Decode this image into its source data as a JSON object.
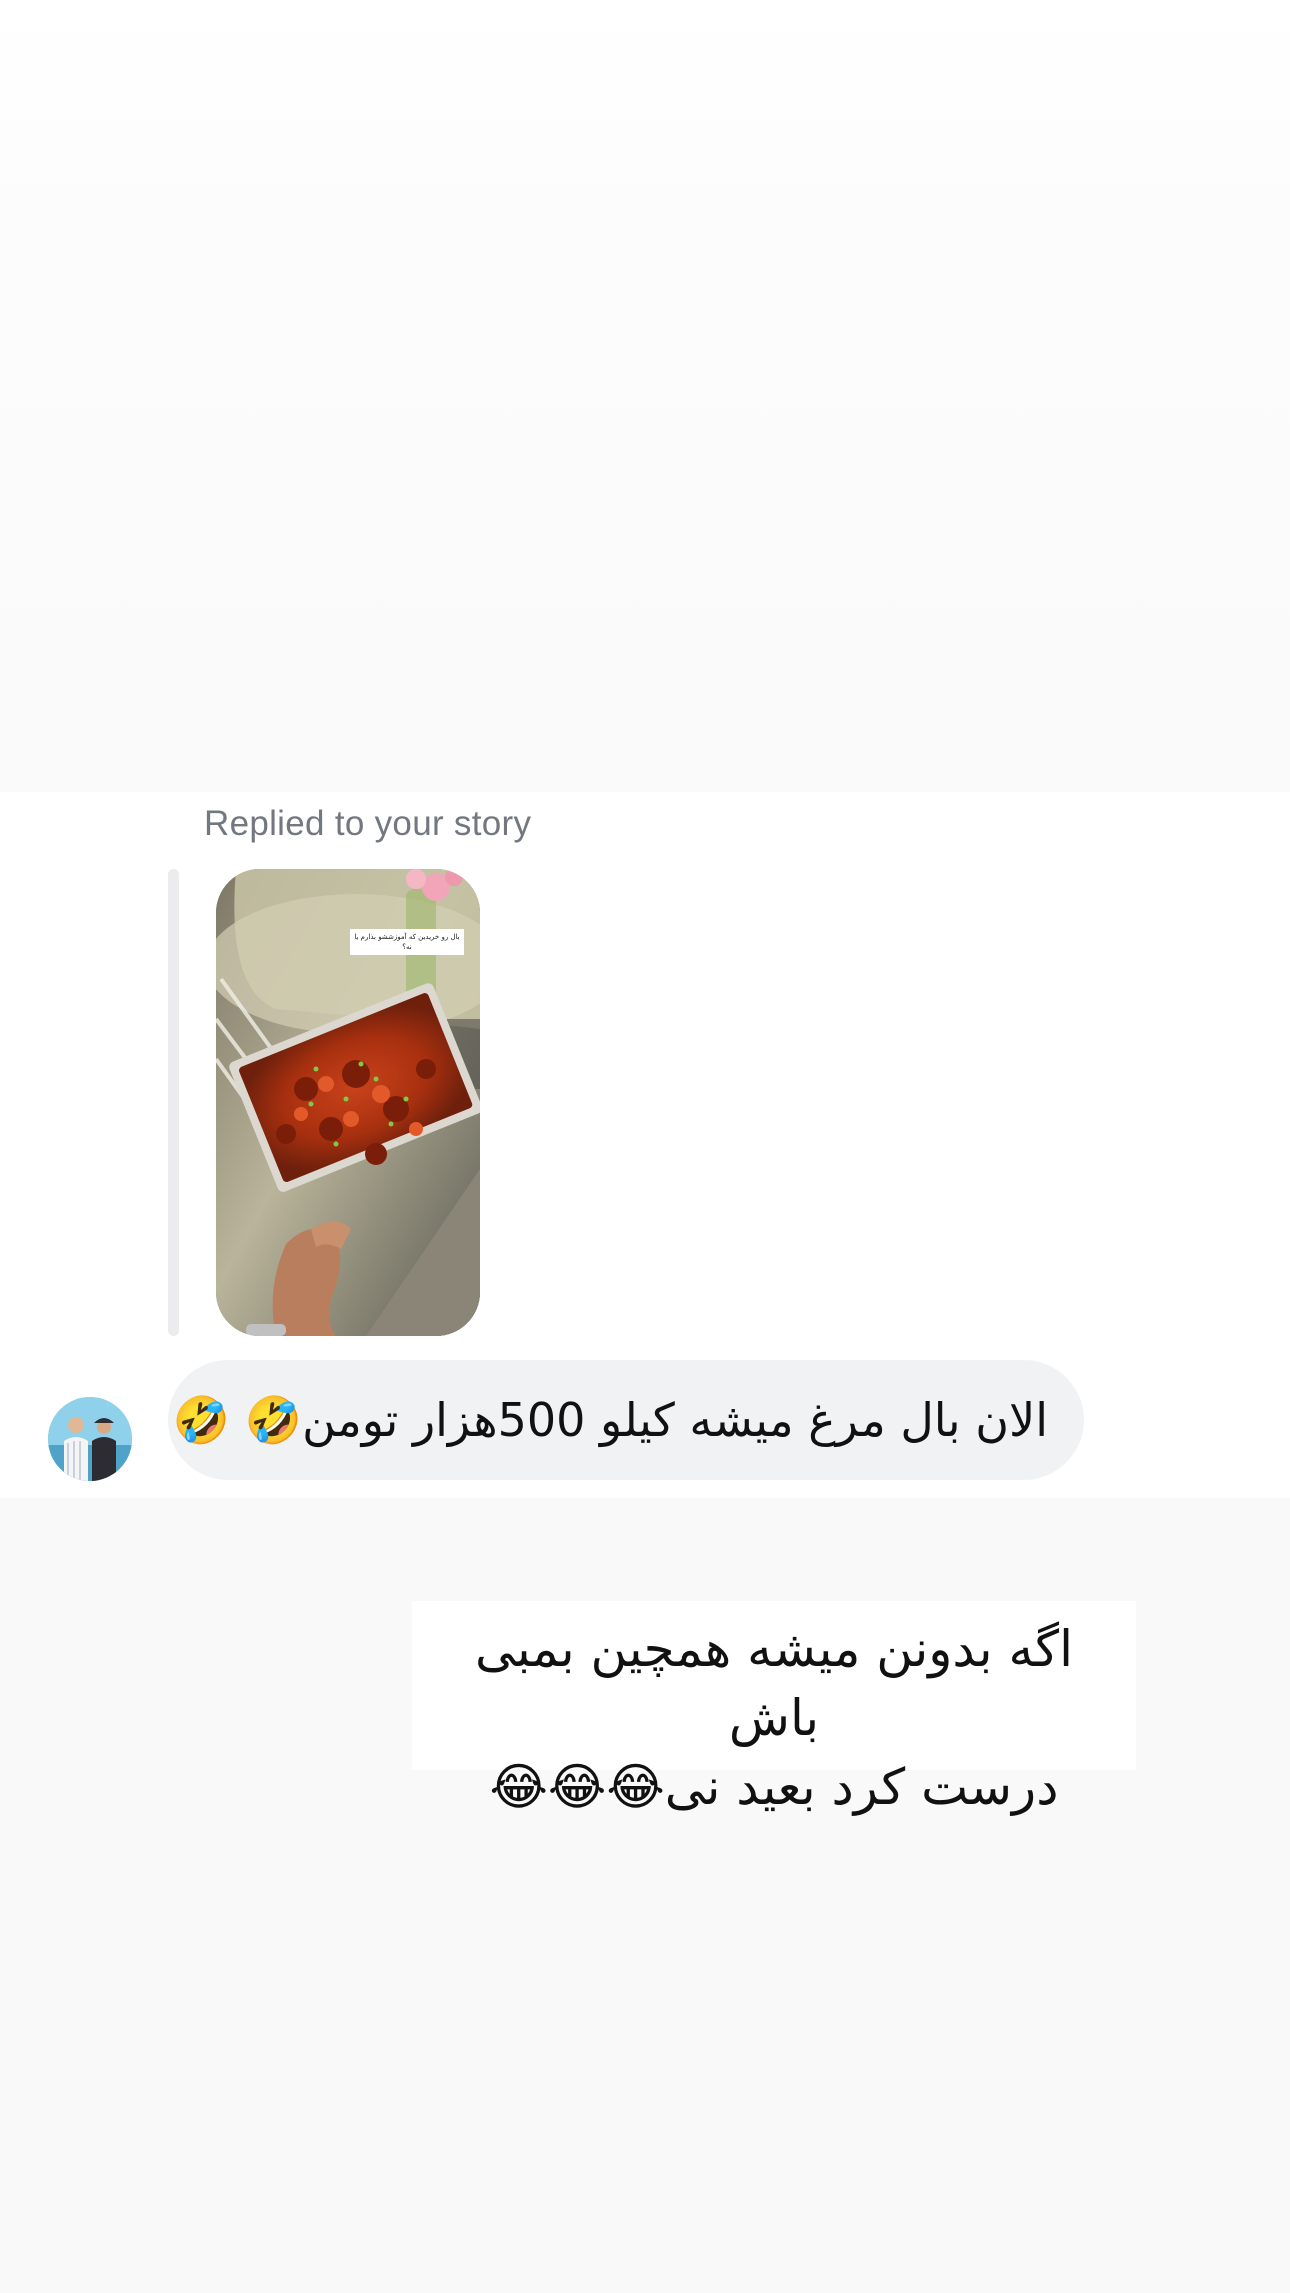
{
  "thread": {
    "reply_label": "Replied to your story",
    "story": {
      "image": "story-photo-fried-chicken-wings-tray",
      "caption": "بال رو خریدین که آموزششو بذارم یا نه؟"
    },
    "message": {
      "sender_avatar": "avatar-photo-two-people",
      "text": "الان بال مرغ میشه کیلو 500هزار تومن🤣 🤣"
    }
  },
  "note": {
    "line1": "اگه بدونن میشه همچین بمبی باش",
    "line2": "درست کرد بعید نی😂😂😂"
  },
  "colors": {
    "bubble_background": "#f1f2f4",
    "reply_label": "#737780",
    "reply_bar": "#ececee"
  }
}
